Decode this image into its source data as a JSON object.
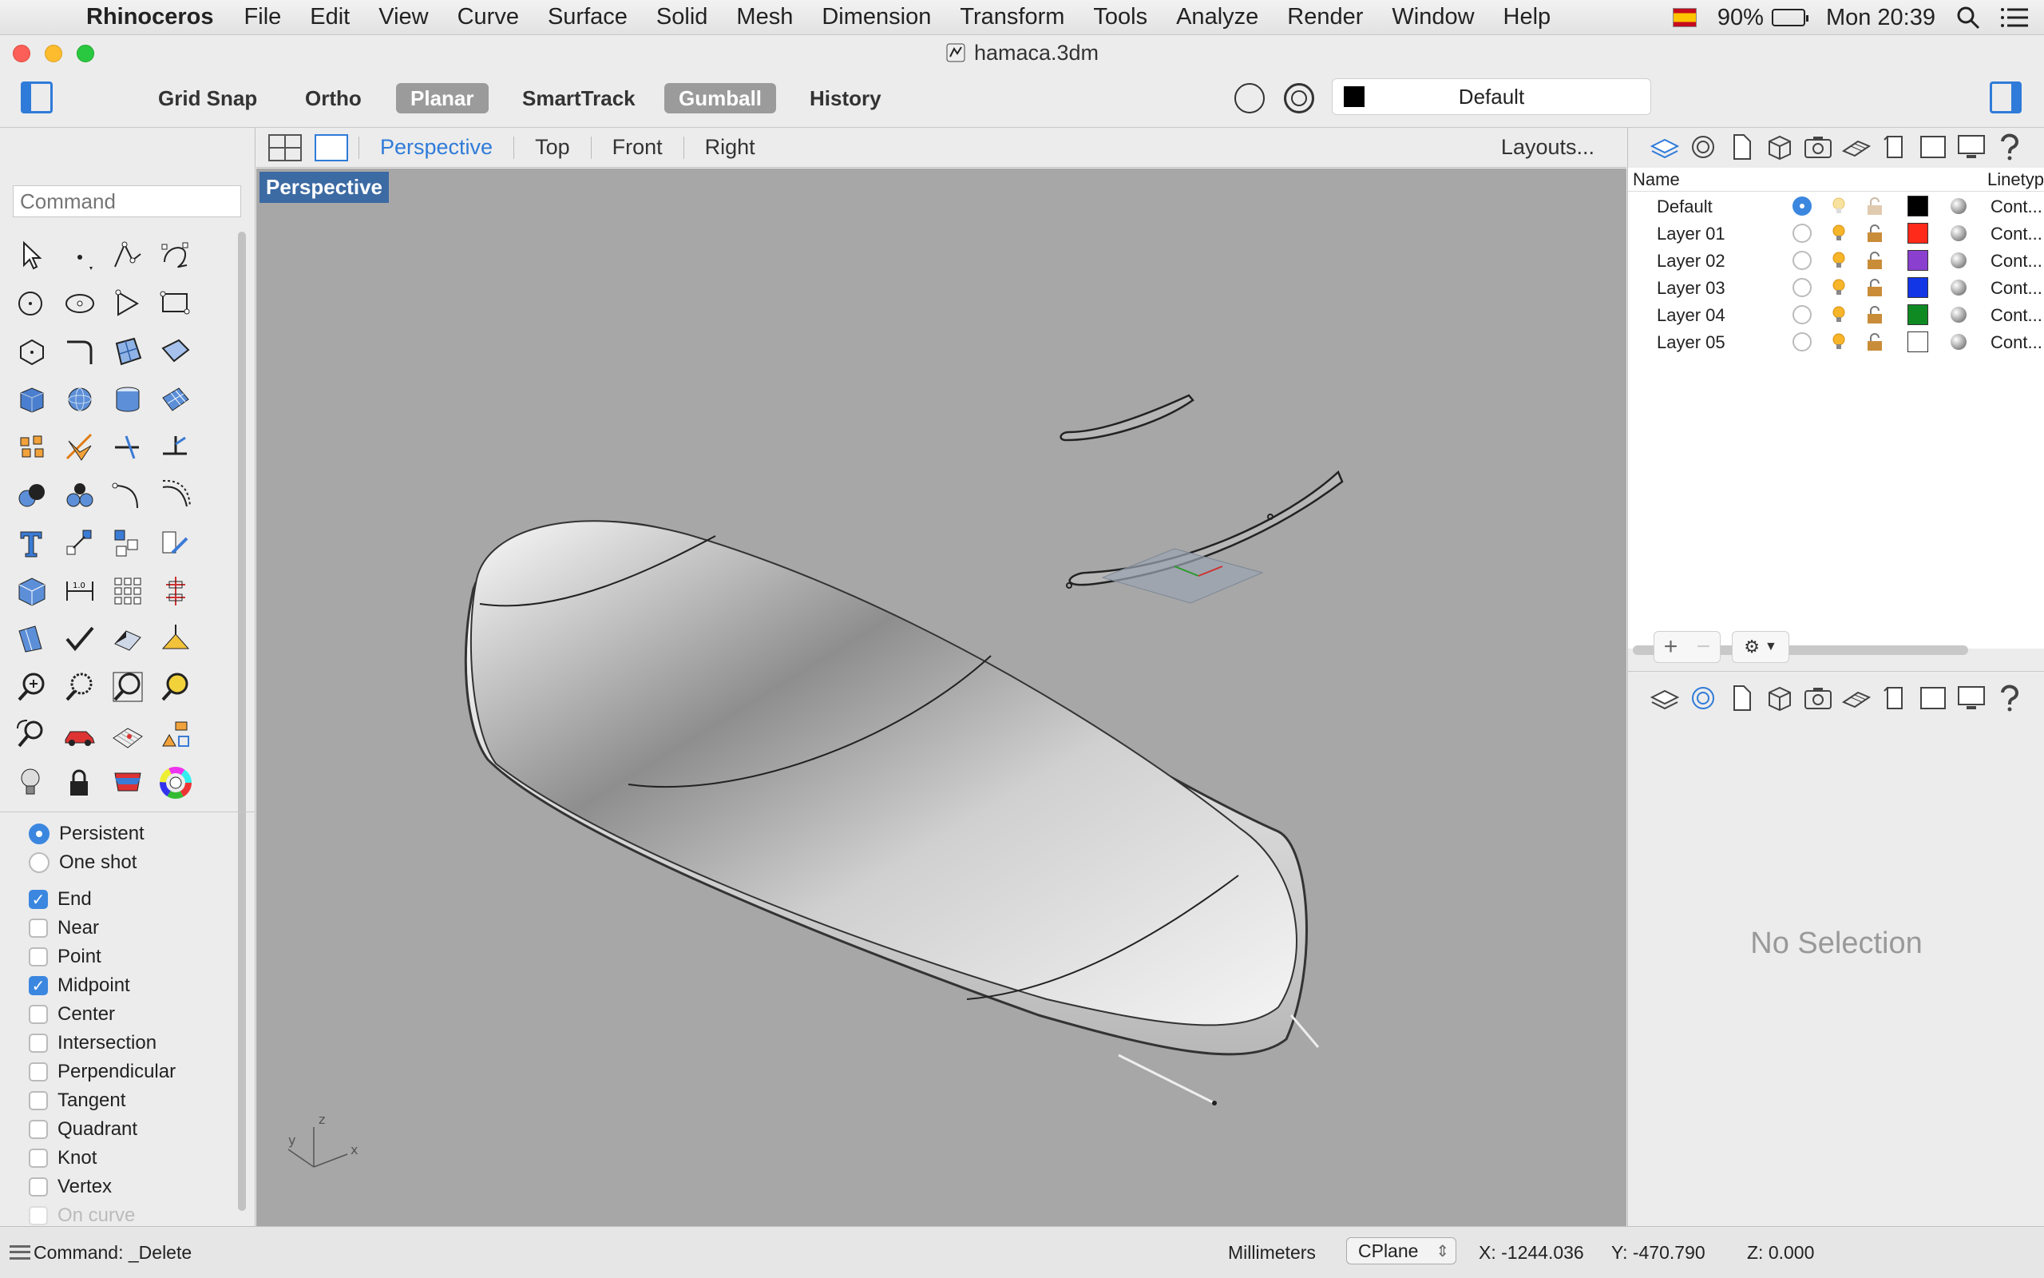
{
  "menubar": {
    "app_name": "Rhinoceros",
    "items": [
      "File",
      "Edit",
      "View",
      "Curve",
      "Surface",
      "Solid",
      "Mesh",
      "Dimension",
      "Transform",
      "Tools",
      "Analyze",
      "Render",
      "Window",
      "Help"
    ],
    "battery": "90%",
    "clock": "Mon 20:39"
  },
  "window": {
    "title": "hamaca.3dm"
  },
  "toolbar": {
    "grid_snap": "Grid Snap",
    "ortho": "Ortho",
    "planar": "Planar",
    "smarttrack": "SmartTrack",
    "gumball": "Gumball",
    "history": "History",
    "current_layer": "Default"
  },
  "command": {
    "placeholder": "Command"
  },
  "osnap": {
    "mode": [
      {
        "label": "Persistent",
        "on": true
      },
      {
        "label": "One shot",
        "on": false
      }
    ],
    "items": [
      {
        "label": "End",
        "on": true
      },
      {
        "label": "Near",
        "on": false
      },
      {
        "label": "Point",
        "on": false
      },
      {
        "label": "Midpoint",
        "on": true
      },
      {
        "label": "Center",
        "on": false
      },
      {
        "label": "Intersection",
        "on": false
      },
      {
        "label": "Perpendicular",
        "on": false
      },
      {
        "label": "Tangent",
        "on": false
      },
      {
        "label": "Quadrant",
        "on": false
      },
      {
        "label": "Knot",
        "on": false
      },
      {
        "label": "Vertex",
        "on": false
      },
      {
        "label": "On curve",
        "on": false,
        "disabled": true
      }
    ]
  },
  "viewport_tabs": {
    "tabs": [
      "Perspective",
      "Top",
      "Front",
      "Right"
    ],
    "active": "Perspective",
    "layouts": "Layouts..."
  },
  "viewport": {
    "label": "Perspective",
    "axes": {
      "x": "x",
      "y": "y",
      "z": "z"
    }
  },
  "layers": {
    "headers": {
      "name": "Name",
      "linetype": "Linetyp"
    },
    "rows": [
      {
        "name": "Default",
        "current": true,
        "color": "#000000",
        "linetype": "Cont..."
      },
      {
        "name": "Layer 01",
        "current": false,
        "color": "#ff2a1a",
        "linetype": "Cont..."
      },
      {
        "name": "Layer 02",
        "current": false,
        "color": "#8b3fcf",
        "linetype": "Cont..."
      },
      {
        "name": "Layer 03",
        "current": false,
        "color": "#1236e6",
        "linetype": "Cont..."
      },
      {
        "name": "Layer 04",
        "current": false,
        "color": "#0f8a23",
        "linetype": "Cont..."
      },
      {
        "name": "Layer 05",
        "current": false,
        "color": "#ffffff",
        "linetype": "Cont..."
      }
    ]
  },
  "properties": {
    "empty_text": "No Selection"
  },
  "status": {
    "command": "Command: _Delete",
    "units": "Millimeters",
    "cplane": "CPlane",
    "x": "X: -1244.036",
    "y": "Y: -470.790",
    "z": "Z: 0.000"
  },
  "colors": {
    "accent": "#2f7bd9",
    "viewport_bg": "#a7a7a7",
    "viewport_label_bg": "#3c6aa3"
  }
}
